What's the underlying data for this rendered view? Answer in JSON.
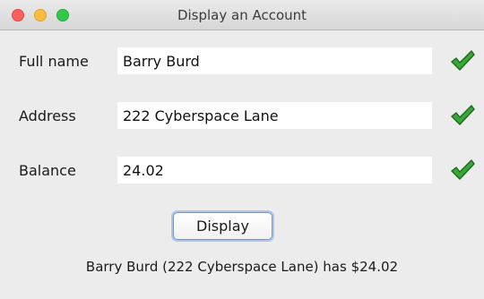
{
  "window": {
    "title": "Display an Account"
  },
  "form": {
    "rows": [
      {
        "label": "Full name",
        "value": "Barry Burd",
        "valid": true
      },
      {
        "label": "Address",
        "value": "222 Cyberspace Lane",
        "valid": true
      },
      {
        "label": "Balance",
        "value": "24.02",
        "valid": true
      }
    ],
    "check_icon": "checkmark-icon",
    "check_color": "#3aa63a"
  },
  "actions": {
    "display_label": "Display"
  },
  "output": {
    "result_text": "Barry Burd (222 Cyberspace Lane) has $24.02"
  },
  "colors": {
    "window_bg": "#ececec",
    "close": "#fc605c",
    "minimize": "#fdbc40",
    "zoom": "#34c84a",
    "button_focus": "#5b9bf0"
  }
}
